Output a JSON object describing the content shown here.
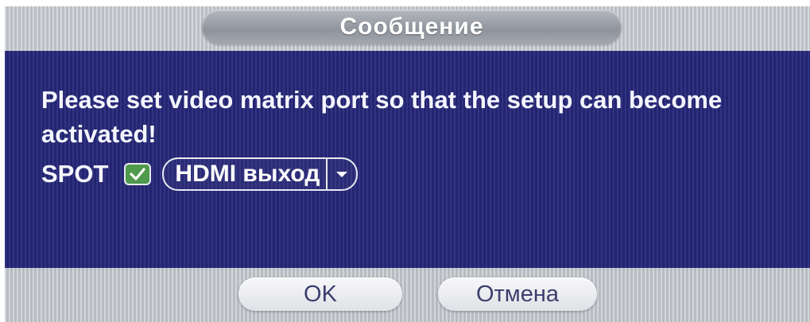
{
  "dialog": {
    "title": "Сообщение",
    "message": "Please set video matrix port so that the setup can become activated!",
    "spot": {
      "label": "SPOT",
      "checked": true,
      "select_value": "HDMI выход"
    },
    "buttons": {
      "ok_label": "OK",
      "cancel_label": "Отмена"
    }
  },
  "colors": {
    "body_blue": "#27287a",
    "strip_grey": "#c9cdd3",
    "checkbox_green": "#4f9a4c",
    "text_white": "#f4f6ff"
  },
  "icons": {
    "checkbox": "check-icon",
    "dropdown": "chevron-down-icon"
  }
}
